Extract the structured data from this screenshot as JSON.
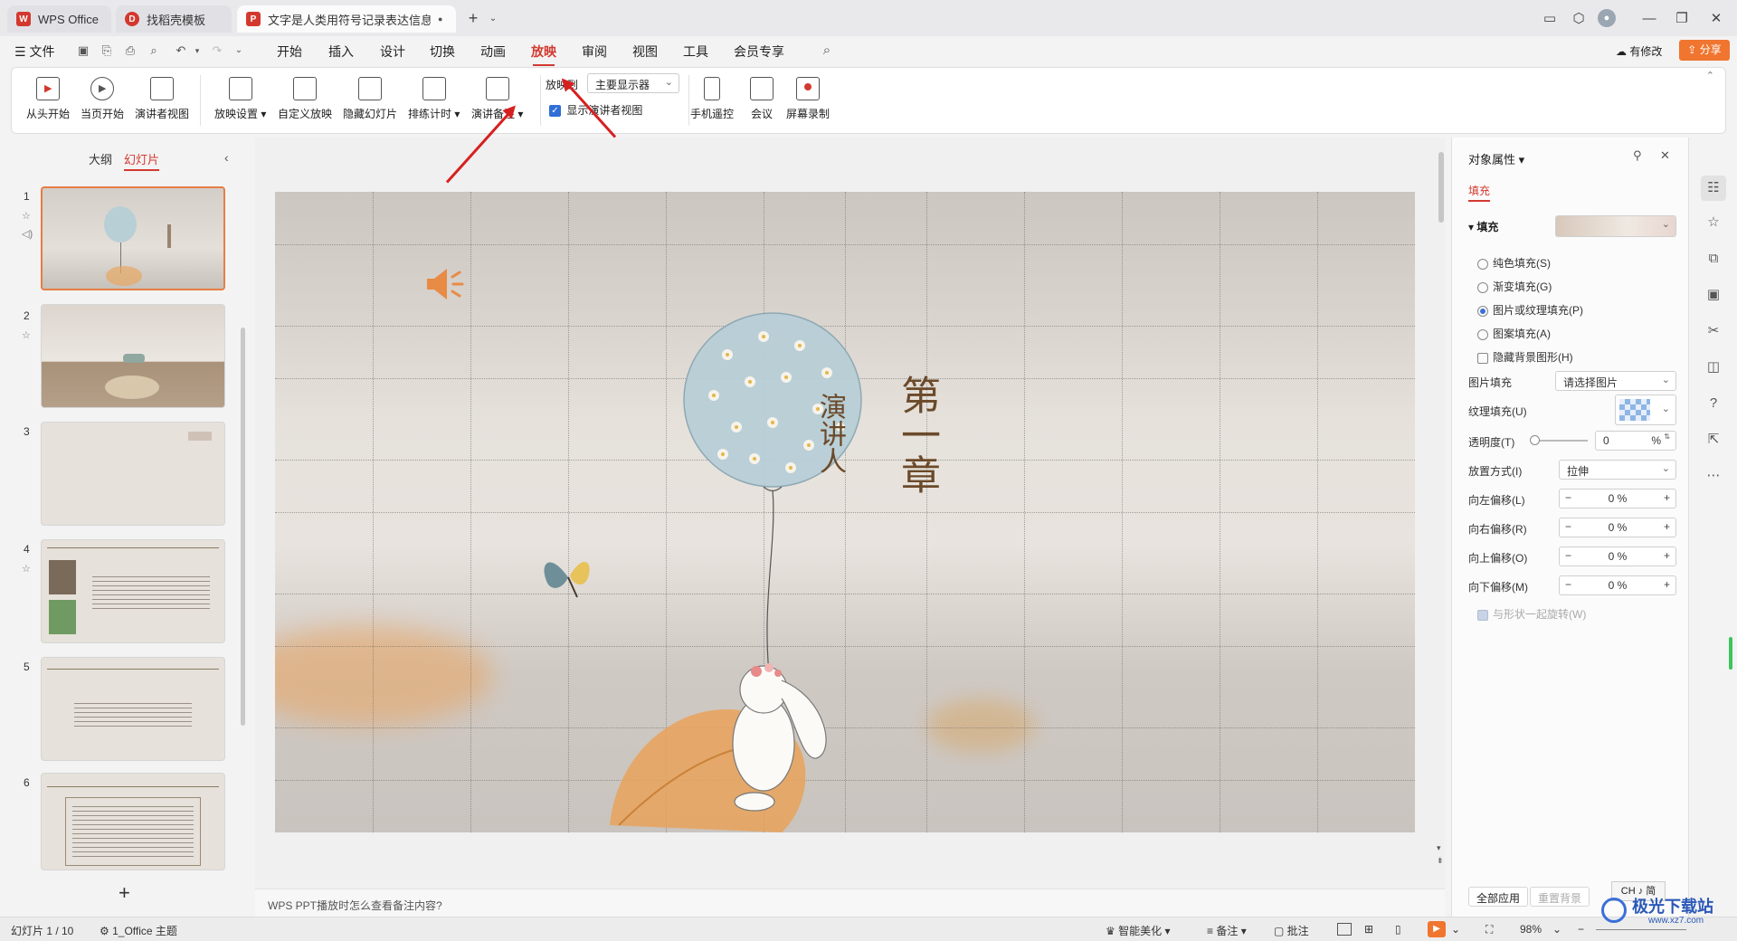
{
  "titlebar": {
    "tabs": [
      {
        "label": "WPS Office",
        "color": "#d3382f",
        "glyph": "W"
      },
      {
        "label": "找稻壳模板",
        "color": "#d3382f",
        "glyph": "D"
      },
      {
        "label": "文字是人类用符号记录表达信息以",
        "color": "#d3382f",
        "glyph": "P"
      }
    ],
    "new_tab": "+"
  },
  "menubar": {
    "file": "文件",
    "items": [
      "开始",
      "插入",
      "设计",
      "切换",
      "动画",
      "放映",
      "审阅",
      "视图",
      "工具",
      "会员专享"
    ],
    "active": "放映",
    "revise": "有修改",
    "share": "分享"
  },
  "ribbon": {
    "buttons": [
      {
        "label": "从头开始",
        "icon": "play-from-start-icon"
      },
      {
        "label": "当页开始",
        "icon": "play-current-icon"
      },
      {
        "label": "演讲者视图",
        "icon": "presenter-view-icon"
      },
      {
        "label": "放映设置",
        "icon": "slideshow-settings-icon"
      },
      {
        "label": "自定义放映",
        "icon": "custom-show-icon"
      },
      {
        "label": "隐藏幻灯片",
        "icon": "hide-slide-icon"
      },
      {
        "label": "排练计时",
        "icon": "rehearse-timing-icon"
      },
      {
        "label": "演讲备注",
        "icon": "speaker-notes-icon"
      },
      {
        "label": "手机遥控",
        "icon": "phone-remote-icon"
      },
      {
        "label": "会议",
        "icon": "meeting-icon"
      },
      {
        "label": "屏幕录制",
        "icon": "screen-record-icon"
      }
    ],
    "show_to_label": "放映到",
    "show_to_value": "主要显示器",
    "presenter_checkbox": "显示演讲者视图"
  },
  "leftpanel": {
    "tab_outline": "大纲",
    "tab_slides": "幻灯片",
    "slides": [
      1,
      2,
      3,
      4,
      5,
      6
    ],
    "add": "+"
  },
  "slide": {
    "chapter": "第一章",
    "speaker": "演讲人"
  },
  "notes_placeholder": "WPS PPT播放时怎么查看备注内容?",
  "rightpanel": {
    "title": "对象属性",
    "tab_fill": "填充",
    "fill_section": "填充",
    "options": [
      "纯色填充(S)",
      "渐变填充(G)",
      "图片或纹理填充(P)",
      "图案填充(A)"
    ],
    "hide_bg": "隐藏背景图形(H)",
    "picture_fill_label": "图片填充",
    "picture_fill_value": "请选择图片",
    "texture_fill_label": "纹理填充(U)",
    "transparency_label": "透明度(T)",
    "transparency_value": "0",
    "transparency_unit": "%",
    "placement_label": "放置方式(I)",
    "placement_value": "拉伸",
    "offsets": [
      {
        "label": "向左偏移(L)",
        "value": "0 %"
      },
      {
        "label": "向右偏移(R)",
        "value": "0 %"
      },
      {
        "label": "向上偏移(O)",
        "value": "0 %"
      },
      {
        "label": "向下偏移(M)",
        "value": "0 %"
      }
    ],
    "rotate_with_shape": "与形状一起旋转(W)",
    "apply_all": "全部应用",
    "reset_bg": "重置背景"
  },
  "statusbar": {
    "slide_count": "幻灯片 1 / 10",
    "theme": "1_Office 主题",
    "beautify": "智能美化",
    "notes": "备注",
    "comments": "批注",
    "zoom": "98%",
    "ime": "CH ♪ 简"
  },
  "watermark": {
    "text": "极光下载站",
    "url": "www.xz7.com"
  },
  "colors": {
    "accent": "#d3382f",
    "selected_thumb": "#e67e45",
    "share_btn": "#f0752f"
  }
}
